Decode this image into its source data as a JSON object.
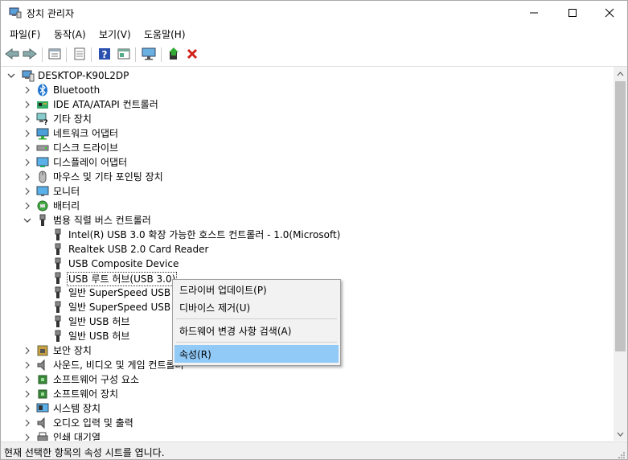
{
  "window": {
    "title": "장치 관리자"
  },
  "menubar": {
    "items": [
      "파일(F)",
      "동작(A)",
      "보기(V)",
      "도움말(H)"
    ]
  },
  "toolbar": {
    "buttons": [
      "back-icon",
      "forward-icon",
      "properties-icon",
      "show-hide-icon",
      "help-icon",
      "action-icon",
      "monitor-icon",
      "update-driver-icon",
      "uninstall-icon"
    ]
  },
  "tree": {
    "root": "DESKTOP-K90L2DP",
    "categories": [
      "Bluetooth",
      "IDE ATA/ATAPI 컨트롤러",
      "기타 장치",
      "네트워크 어댑터",
      "디스크 드라이브",
      "디스플레이 어댑터",
      "마우스 및 기타 포인팅 장치",
      "모니터",
      "배터리",
      "범용 직렬 버스 컨트롤러"
    ],
    "usb_children": [
      "Intel(R) USB 3.0 확장 가능한 호스트 컨트롤러 - 1.0(Microsoft)",
      "Realtek USB 2.0 Card Reader",
      "USB Composite Device",
      "USB 루트 허브(USB 3.0)",
      "일반 SuperSpeed USB 허브",
      "일반 SuperSpeed USB 허브",
      "일반 USB 허브",
      "일반 USB 허브"
    ],
    "categories_after": [
      "보안 장치",
      "사운드, 비디오 및 게임 컨트롤러",
      "소프트웨어 구성 요소",
      "소프트웨어 장치",
      "시스템 장치",
      "오디오 입력 및 출력",
      "인쇄 대기열"
    ]
  },
  "context_menu": {
    "update_driver": "드라이버 업데이트(P)",
    "uninstall": "디바이스 제거(U)",
    "scan": "하드웨어 변경 사항 검색(A)",
    "properties": "속성(R)"
  },
  "status": {
    "text": "현재 선택한 항목의 속성 시트를 엽니다."
  }
}
